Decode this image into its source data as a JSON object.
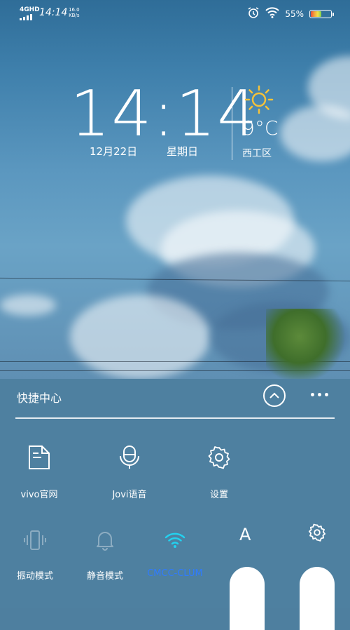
{
  "status_bar": {
    "network": "4GHD",
    "time": "14:14",
    "speed_value": "16.0",
    "speed_unit": "KB/s",
    "battery": "55%",
    "battery_level": 0.55
  },
  "clock_widget": {
    "time": "14:14",
    "date": "12月22日",
    "weekday": "星期日",
    "temperature": "9°C",
    "location": "西工区",
    "weather_icon": "sun-icon"
  },
  "control_center": {
    "title": "快捷中心",
    "shortcuts": [
      {
        "label": "vivo官网",
        "icon": "document-icon"
      },
      {
        "label": "Jovi语音",
        "icon": "microphone-icon"
      },
      {
        "label": "设置",
        "icon": "gear-icon"
      }
    ],
    "toggles": [
      {
        "label": "振动模式",
        "icon": "vibrate-icon",
        "active": false
      },
      {
        "label": "静音模式",
        "icon": "bell-icon",
        "active": false
      },
      {
        "label": "CMCC-CLUM",
        "icon": "wifi-icon",
        "active": true
      }
    ],
    "font_button": "A",
    "colors": {
      "active": "#2f7bff",
      "panel": "#4e80a0"
    }
  }
}
